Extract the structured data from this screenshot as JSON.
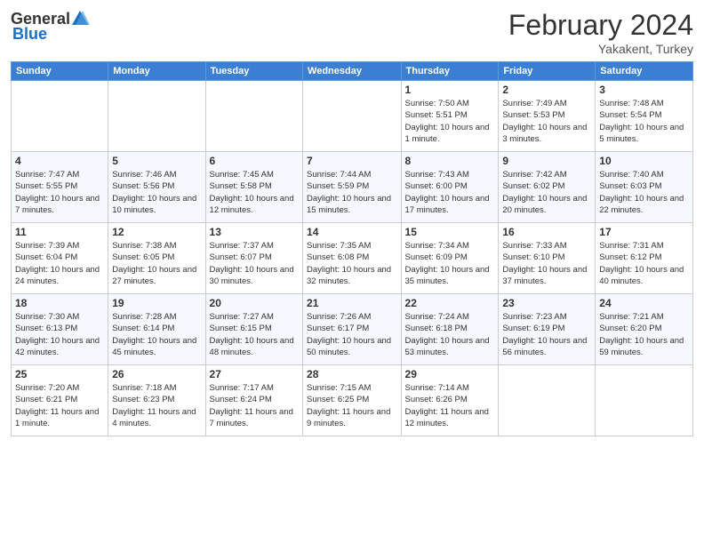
{
  "header": {
    "logo_general": "General",
    "logo_blue": "Blue",
    "month_title": "February 2024",
    "location": "Yakakent, Turkey"
  },
  "days_of_week": [
    "Sunday",
    "Monday",
    "Tuesday",
    "Wednesday",
    "Thursday",
    "Friday",
    "Saturday"
  ],
  "weeks": [
    [
      {
        "day": "",
        "info": ""
      },
      {
        "day": "",
        "info": ""
      },
      {
        "day": "",
        "info": ""
      },
      {
        "day": "",
        "info": ""
      },
      {
        "day": "1",
        "info": "Sunrise: 7:50 AM\nSunset: 5:51 PM\nDaylight: 10 hours and 1 minute."
      },
      {
        "day": "2",
        "info": "Sunrise: 7:49 AM\nSunset: 5:53 PM\nDaylight: 10 hours and 3 minutes."
      },
      {
        "day": "3",
        "info": "Sunrise: 7:48 AM\nSunset: 5:54 PM\nDaylight: 10 hours and 5 minutes."
      }
    ],
    [
      {
        "day": "4",
        "info": "Sunrise: 7:47 AM\nSunset: 5:55 PM\nDaylight: 10 hours and 7 minutes."
      },
      {
        "day": "5",
        "info": "Sunrise: 7:46 AM\nSunset: 5:56 PM\nDaylight: 10 hours and 10 minutes."
      },
      {
        "day": "6",
        "info": "Sunrise: 7:45 AM\nSunset: 5:58 PM\nDaylight: 10 hours and 12 minutes."
      },
      {
        "day": "7",
        "info": "Sunrise: 7:44 AM\nSunset: 5:59 PM\nDaylight: 10 hours and 15 minutes."
      },
      {
        "day": "8",
        "info": "Sunrise: 7:43 AM\nSunset: 6:00 PM\nDaylight: 10 hours and 17 minutes."
      },
      {
        "day": "9",
        "info": "Sunrise: 7:42 AM\nSunset: 6:02 PM\nDaylight: 10 hours and 20 minutes."
      },
      {
        "day": "10",
        "info": "Sunrise: 7:40 AM\nSunset: 6:03 PM\nDaylight: 10 hours and 22 minutes."
      }
    ],
    [
      {
        "day": "11",
        "info": "Sunrise: 7:39 AM\nSunset: 6:04 PM\nDaylight: 10 hours and 24 minutes."
      },
      {
        "day": "12",
        "info": "Sunrise: 7:38 AM\nSunset: 6:05 PM\nDaylight: 10 hours and 27 minutes."
      },
      {
        "day": "13",
        "info": "Sunrise: 7:37 AM\nSunset: 6:07 PM\nDaylight: 10 hours and 30 minutes."
      },
      {
        "day": "14",
        "info": "Sunrise: 7:35 AM\nSunset: 6:08 PM\nDaylight: 10 hours and 32 minutes."
      },
      {
        "day": "15",
        "info": "Sunrise: 7:34 AM\nSunset: 6:09 PM\nDaylight: 10 hours and 35 minutes."
      },
      {
        "day": "16",
        "info": "Sunrise: 7:33 AM\nSunset: 6:10 PM\nDaylight: 10 hours and 37 minutes."
      },
      {
        "day": "17",
        "info": "Sunrise: 7:31 AM\nSunset: 6:12 PM\nDaylight: 10 hours and 40 minutes."
      }
    ],
    [
      {
        "day": "18",
        "info": "Sunrise: 7:30 AM\nSunset: 6:13 PM\nDaylight: 10 hours and 42 minutes."
      },
      {
        "day": "19",
        "info": "Sunrise: 7:28 AM\nSunset: 6:14 PM\nDaylight: 10 hours and 45 minutes."
      },
      {
        "day": "20",
        "info": "Sunrise: 7:27 AM\nSunset: 6:15 PM\nDaylight: 10 hours and 48 minutes."
      },
      {
        "day": "21",
        "info": "Sunrise: 7:26 AM\nSunset: 6:17 PM\nDaylight: 10 hours and 50 minutes."
      },
      {
        "day": "22",
        "info": "Sunrise: 7:24 AM\nSunset: 6:18 PM\nDaylight: 10 hours and 53 minutes."
      },
      {
        "day": "23",
        "info": "Sunrise: 7:23 AM\nSunset: 6:19 PM\nDaylight: 10 hours and 56 minutes."
      },
      {
        "day": "24",
        "info": "Sunrise: 7:21 AM\nSunset: 6:20 PM\nDaylight: 10 hours and 59 minutes."
      }
    ],
    [
      {
        "day": "25",
        "info": "Sunrise: 7:20 AM\nSunset: 6:21 PM\nDaylight: 11 hours and 1 minute."
      },
      {
        "day": "26",
        "info": "Sunrise: 7:18 AM\nSunset: 6:23 PM\nDaylight: 11 hours and 4 minutes."
      },
      {
        "day": "27",
        "info": "Sunrise: 7:17 AM\nSunset: 6:24 PM\nDaylight: 11 hours and 7 minutes."
      },
      {
        "day": "28",
        "info": "Sunrise: 7:15 AM\nSunset: 6:25 PM\nDaylight: 11 hours and 9 minutes."
      },
      {
        "day": "29",
        "info": "Sunrise: 7:14 AM\nSunset: 6:26 PM\nDaylight: 11 hours and 12 minutes."
      },
      {
        "day": "",
        "info": ""
      },
      {
        "day": "",
        "info": ""
      }
    ]
  ]
}
